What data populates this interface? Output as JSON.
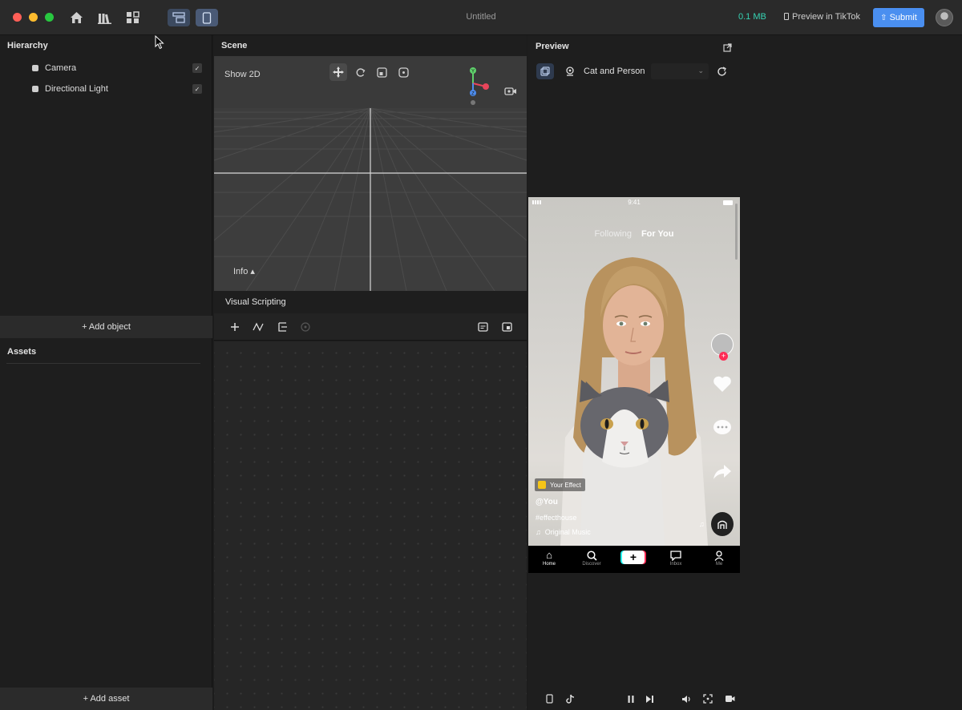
{
  "titlebar": {
    "title": "Untitled",
    "project_size": "0.1 MB",
    "preview_button": "Preview in TikTok",
    "submit_button": "Submit"
  },
  "hierarchy": {
    "title": "Hierarchy",
    "items": [
      {
        "label": "Camera",
        "checked": "✓"
      },
      {
        "label": "Directional Light",
        "checked": "✓"
      }
    ],
    "add_object": "+ Add object"
  },
  "assets": {
    "title": "Assets",
    "add_asset": "+ Add asset"
  },
  "scene": {
    "title": "Scene",
    "show_2d": "Show 2D",
    "info": "Info ▴",
    "gizmo_y": "Y",
    "gizmo_z": "Z"
  },
  "visual_scripting": {
    "title": "Visual Scripting"
  },
  "preview": {
    "title": "Preview",
    "simulation": "Cat and Person"
  },
  "phone": {
    "time": "9:41",
    "tab_following": "Following",
    "tab_for_you": "For You",
    "effect_badge": "Your Effect",
    "username": "@You",
    "hashtag": "#effecthouse",
    "music": "Original Music",
    "nav": [
      {
        "label": "Home"
      },
      {
        "label": "Discover"
      },
      {
        "label": ""
      },
      {
        "label": "Inbox"
      },
      {
        "label": "Me"
      }
    ]
  },
  "colors": {
    "accent": "#4a8ff0",
    "size_text": "#36d3b3",
    "close": "#ff5f57",
    "minimize": "#febc2e",
    "zoom": "#28c840"
  }
}
